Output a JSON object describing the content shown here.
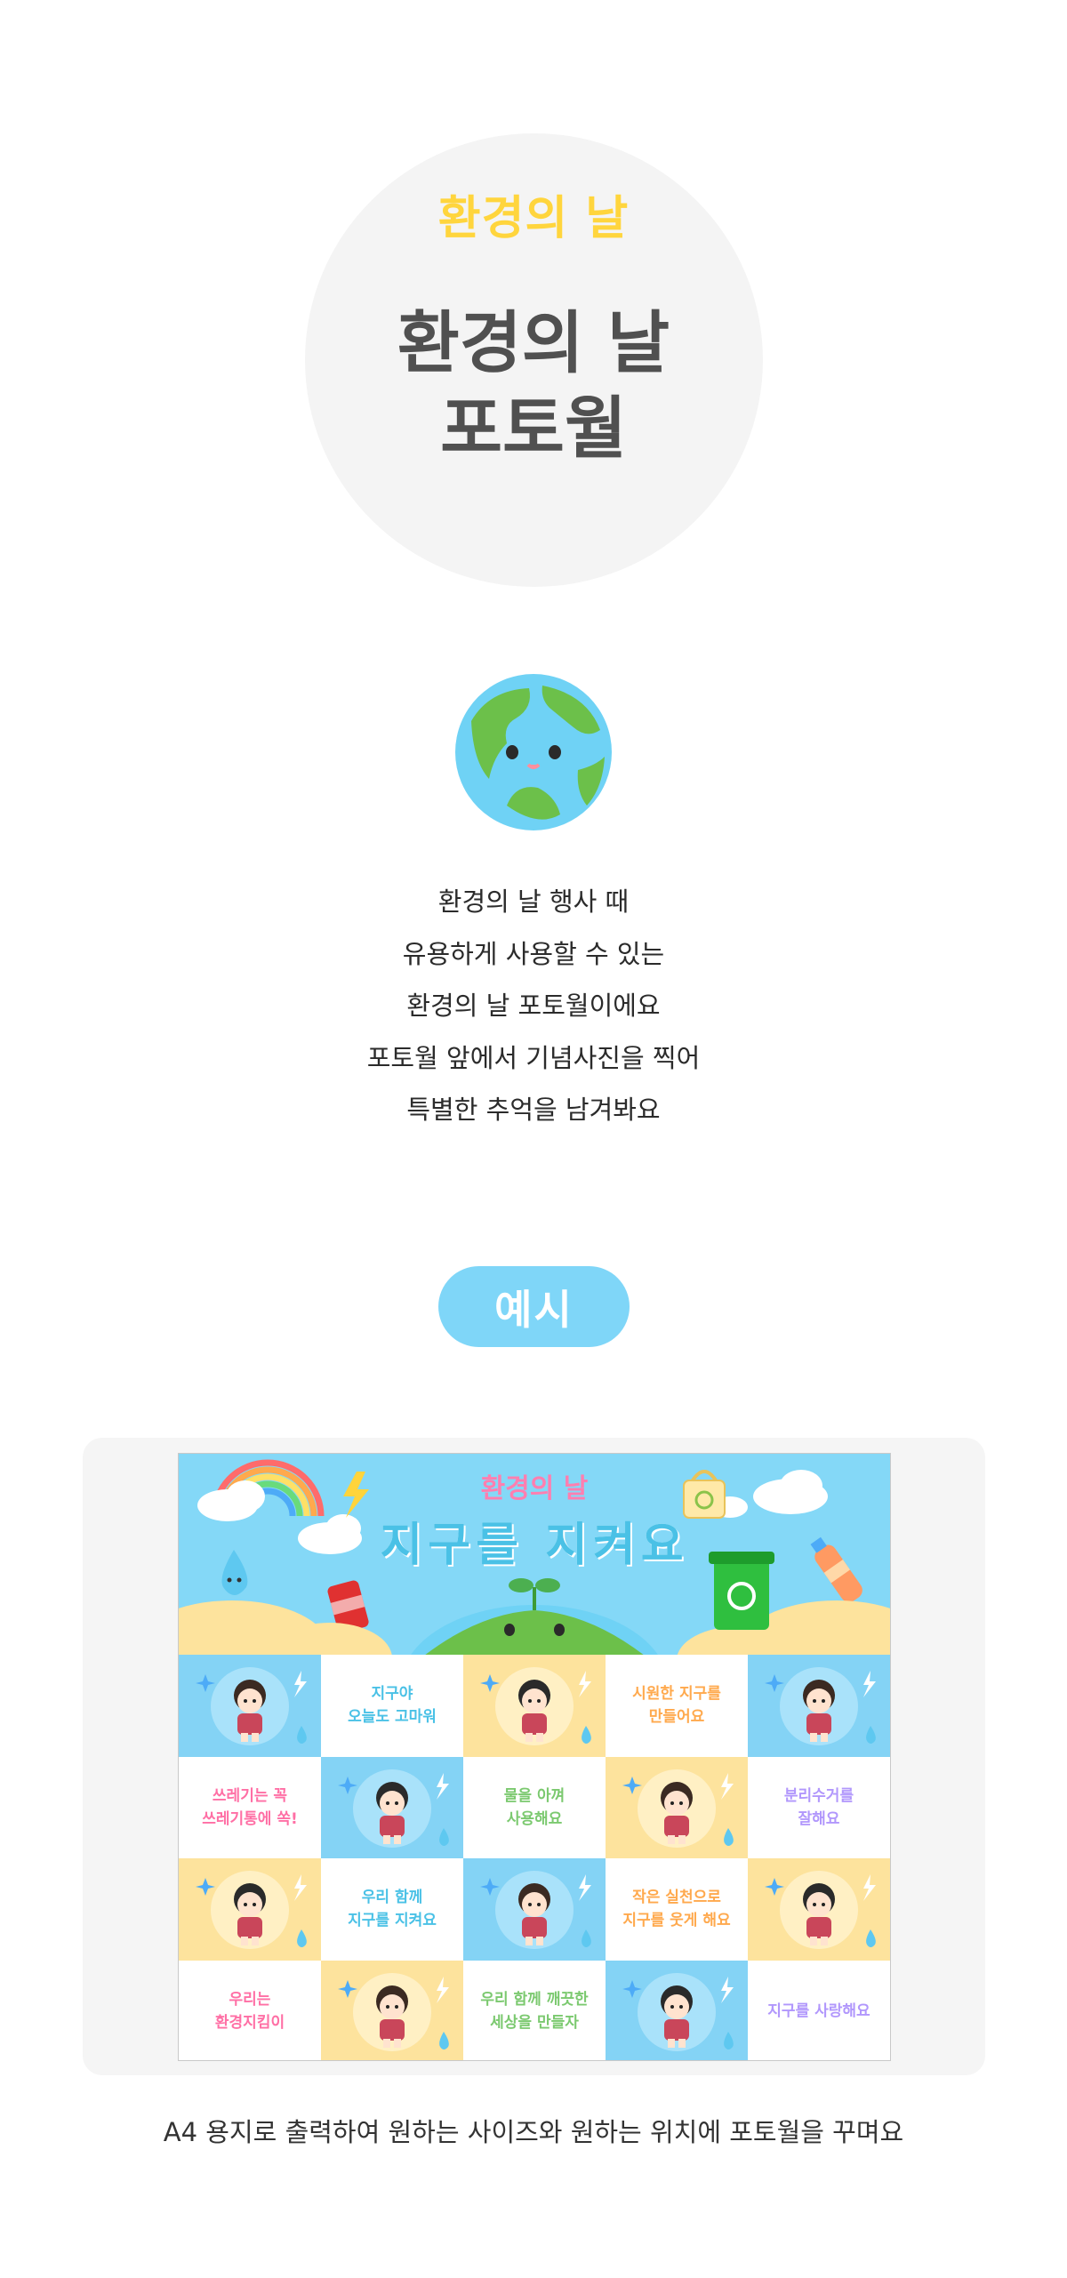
{
  "hero": {
    "subtitle": "환경의 날",
    "title_line1": "환경의 날",
    "title_line2": "포토월"
  },
  "icons": {
    "globe": "smiling-earth-icon"
  },
  "description": {
    "lines": [
      "환경의 날 행사 때",
      "유용하게 사용할 수 있는",
      "환경의 날 포토월이에요",
      "포토월 앞에서 기념사진을 찍어",
      "특별한 추억을 남겨봐요"
    ]
  },
  "example": {
    "label": "예시"
  },
  "poster": {
    "subtitle": "환경의 날",
    "title": "지구를 지켜요",
    "cells": [
      {
        "type": "kid",
        "bg": "blue",
        "text": ""
      },
      {
        "type": "text",
        "bg": "white",
        "text": "지구야\n오늘도 고마워"
      },
      {
        "type": "kid",
        "bg": "yellow",
        "text": ""
      },
      {
        "type": "text",
        "bg": "white",
        "text": "시원한 지구를\n만들어요"
      },
      {
        "type": "kid",
        "bg": "blue",
        "text": ""
      },
      {
        "type": "text",
        "bg": "white",
        "text": "쓰레기는 꼭\n쓰레기통에 쏙!"
      },
      {
        "type": "kid",
        "bg": "blue",
        "text": ""
      },
      {
        "type": "text",
        "bg": "white",
        "text": "물을 아껴\n사용해요"
      },
      {
        "type": "kid",
        "bg": "yellow",
        "text": ""
      },
      {
        "type": "text",
        "bg": "white",
        "text": "분리수거를\n잘해요"
      },
      {
        "type": "kid",
        "bg": "yellow",
        "text": ""
      },
      {
        "type": "text",
        "bg": "white",
        "text": "우리 함께\n지구를 지켜요"
      },
      {
        "type": "kid",
        "bg": "blue",
        "text": ""
      },
      {
        "type": "text",
        "bg": "white",
        "text": "작은 실천으로\n지구를 웃게 해요"
      },
      {
        "type": "kid",
        "bg": "yellow",
        "text": ""
      },
      {
        "type": "text",
        "bg": "white",
        "text": "우리는\n환경지킴이"
      },
      {
        "type": "kid",
        "bg": "yellow",
        "text": ""
      },
      {
        "type": "text",
        "bg": "white",
        "text": "우리 함께 깨끗한\n세상을 만들자"
      },
      {
        "type": "kid",
        "bg": "blue",
        "text": ""
      },
      {
        "type": "text",
        "bg": "white",
        "text": "지구를 사랑해요"
      }
    ],
    "colors": {
      "sky": "#84d8f7",
      "sun_yellow": "#fde39d",
      "title": "#4ac1e6",
      "subtitle": "#ff7fb0"
    }
  },
  "caption": "A4 용지로 출력하여 원하는 사이즈와 원하는 위치에 포토월을 꾸며요"
}
